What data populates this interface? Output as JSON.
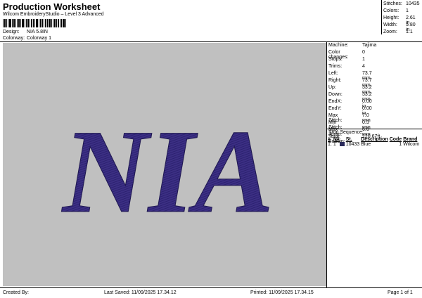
{
  "header": {
    "title": "Production Worksheet",
    "software": "Wilcom EmbroideryStudio – Level 3 Advanced",
    "design_label": "Design:",
    "design_value": "NIA 5.8IN",
    "colorway_label": "Colorway:",
    "colorway_value": "Colorway 1"
  },
  "summary": [
    {
      "label": "Stitches:",
      "value": "10435"
    },
    {
      "label": "Colors:",
      "value": "1"
    },
    {
      "label": "Height:",
      "value": "2.61 in"
    },
    {
      "label": "Width:",
      "value": "5.80 in"
    },
    {
      "label": "Zoom:",
      "value": "1:1"
    }
  ],
  "design": {
    "text": "NIA",
    "thread_color": "#3c2f84",
    "background": "#c0c0c0"
  },
  "machine_info": [
    {
      "label": "Machine:",
      "value": "Tajima"
    },
    {
      "label": "Color changes:",
      "value": "0"
    },
    {
      "label": "Stops:",
      "value": "1"
    },
    {
      "label": "Trims:",
      "value": "4"
    },
    {
      "label": "Left:",
      "value": "73.7 mm"
    },
    {
      "label": "Right:",
      "value": "73.7 mm"
    },
    {
      "label": "Up:",
      "value": "33.2 mm"
    },
    {
      "label": "Down:",
      "value": "33.2 mm"
    },
    {
      "label": "EndX:",
      "value": "0.00 in"
    },
    {
      "label": "EndY:",
      "value": "0.00 in"
    },
    {
      "label": "Max Stitch:",
      "value": "7.0 mm"
    },
    {
      "label": "Min Stitch:",
      "value": "0.3 mm"
    },
    {
      "label": "Max Jump:",
      "value": "6.6 mm"
    },
    {
      "label": "Total Bobbin:",
      "value": "120.67ft"
    }
  ],
  "stop_sequence": {
    "title": "Stop Sequence:",
    "headers": {
      "num": "#",
      "n": "N#",
      "st": "St.",
      "desc": "Description",
      "code": "Code",
      "brand": "Brand"
    },
    "rows": [
      {
        "num": "1.",
        "n": "1",
        "swatch": "#2a2a5a",
        "st": "10433",
        "desc": "Blue",
        "code": "1",
        "brand": "Wilcom"
      }
    ]
  },
  "footer": {
    "created_by": "Created By:",
    "last_saved": "Last Saved: 11/09/2025 17.34.12",
    "printed": "Printed: 11/09/2025 17.34.15",
    "page": "Page 1 of 1"
  }
}
